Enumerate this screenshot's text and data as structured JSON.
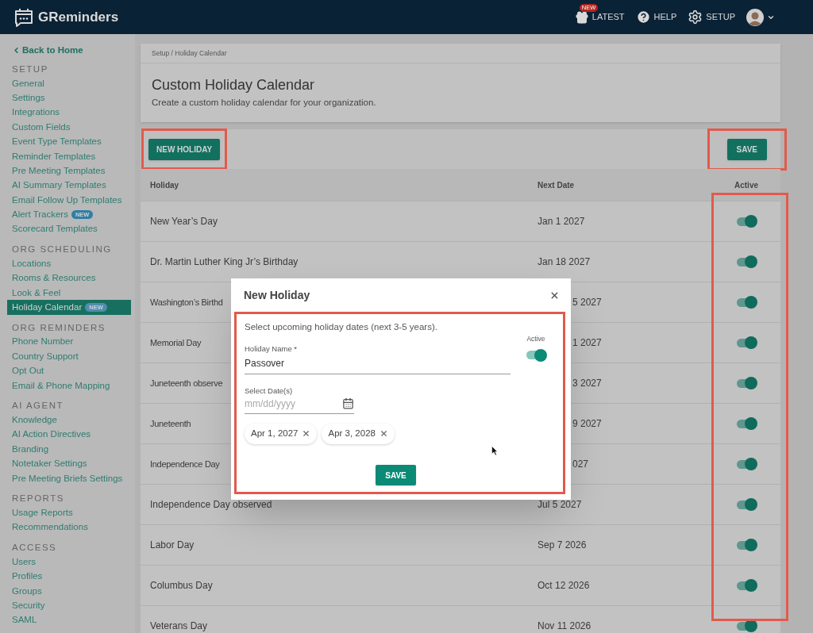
{
  "header": {
    "brand": "GReminders",
    "nav": [
      {
        "kind": "latest",
        "label": "LATEST",
        "badge": "NEW"
      },
      {
        "kind": "help",
        "label": "HELP"
      },
      {
        "kind": "setup",
        "label": "SETUP"
      },
      {
        "kind": "account"
      }
    ]
  },
  "sidebar": {
    "back_link": "Back to Home",
    "sections": [
      {
        "title": "SETUP",
        "items": [
          {
            "label": "General",
            "selected": false
          },
          {
            "label": "Settings",
            "selected": false
          },
          {
            "label": "Integrations",
            "selected": false
          },
          {
            "label": "Custom Fields",
            "selected": false
          },
          {
            "label": "Event Type Templates",
            "selected": false
          },
          {
            "label": "Reminder Templates",
            "selected": false
          },
          {
            "label": "Pre Meeting Templates",
            "selected": false
          },
          {
            "label": "AI Summary Templates",
            "selected": false
          },
          {
            "label": "Email Follow Up Templates",
            "selected": false
          },
          {
            "label": "Alert Trackers",
            "badge": "NEW",
            "selected": false
          },
          {
            "label": "Scorecard Templates",
            "selected": false
          }
        ]
      },
      {
        "title": "ORG SCHEDULING",
        "items": [
          {
            "label": "Locations",
            "selected": false
          },
          {
            "label": "Rooms & Resources",
            "selected": false
          },
          {
            "label": "Look & Feel",
            "selected": false
          },
          {
            "label": "Holiday Calendar",
            "badge": "NEW",
            "selected": true
          }
        ]
      },
      {
        "title": "ORG REMINDERS",
        "items": [
          {
            "label": "Phone Number",
            "selected": false
          },
          {
            "label": "Country Support",
            "selected": false
          },
          {
            "label": "Opt Out",
            "selected": false
          },
          {
            "label": "Email & Phone Mapping",
            "selected": false
          }
        ]
      },
      {
        "title": "AI AGENT",
        "items": [
          {
            "label": "Knowledge",
            "selected": false
          },
          {
            "label": "AI Action Directives",
            "selected": false
          },
          {
            "label": "Branding",
            "selected": false
          },
          {
            "label": "Notetaker Settings",
            "selected": false
          },
          {
            "label": "Pre Meeting Briefs Settings",
            "selected": false
          }
        ]
      },
      {
        "title": "REPORTS",
        "items": [
          {
            "label": "Usage Reports",
            "selected": false
          },
          {
            "label": "Recommendations",
            "selected": false
          }
        ]
      },
      {
        "title": "ACCESS",
        "items": [
          {
            "label": "Users",
            "selected": false
          },
          {
            "label": "Profiles",
            "selected": false
          },
          {
            "label": "Groups",
            "selected": false
          },
          {
            "label": "Security",
            "selected": false
          },
          {
            "label": "SAML",
            "selected": false
          }
        ]
      }
    ]
  },
  "page": {
    "breadcrumb": "Setup / Holiday Calendar",
    "title": "Custom Holiday Calendar",
    "subtitle": "Create a custom holiday calendar for your organization.",
    "new_button": {
      "label": "NEW HOLIDAY",
      "highlighted": true
    },
    "save_button": {
      "label": "SAVE",
      "highlighted": true
    }
  },
  "table": {
    "columns": [
      {
        "label": "Holiday"
      },
      {
        "label": "Next Date"
      },
      {
        "label": "Active",
        "highlighted": true
      }
    ],
    "rows": [
      {
        "holiday": "New Year’s Day",
        "next_date": "Jan 1 2027",
        "active": true,
        "partly_hidden": false
      },
      {
        "holiday": "Dr. Martin Luther King Jr’s Birthday",
        "next_date": "Jan 18 2027",
        "active": true,
        "partly_hidden": false
      },
      {
        "holiday": "Washington’s Birthd",
        "next_date": "5 2027",
        "active": true,
        "partly_hidden": true
      },
      {
        "holiday": "Memorial Day",
        "next_date": "1 2027",
        "active": true,
        "partly_hidden": true
      },
      {
        "holiday": "Juneteenth observe",
        "next_date": "3 2027",
        "active": true,
        "partly_hidden": true
      },
      {
        "holiday": "Juneteenth",
        "next_date": "9 2027",
        "active": true,
        "partly_hidden": true
      },
      {
        "holiday": "Independence Day",
        "next_date": "027",
        "active": true,
        "partly_hidden": true
      },
      {
        "holiday": "Independence Day observed",
        "next_date": "Jul 5 2027",
        "active": true,
        "partly_hidden": false
      },
      {
        "holiday": "Labor Day",
        "next_date": "Sep 7 2026",
        "active": true,
        "partly_hidden": false
      },
      {
        "holiday": "Columbus Day",
        "next_date": "Oct 12 2026",
        "active": true,
        "partly_hidden": false
      },
      {
        "holiday": "Veterans Day",
        "next_date": "Nov 11 2026",
        "active": true,
        "partly_hidden": false
      }
    ]
  },
  "dialog": {
    "title": "New Holiday",
    "highlighted": true,
    "hint": "Select upcoming holiday dates (next 3-5 years).",
    "name_label": "Holiday Name *",
    "name_value": "Passover",
    "active_label": "Active",
    "active": true,
    "date_label": "Select Date(s)",
    "date_placeholder": "mm/dd/yyyy",
    "chips": [
      {
        "label": "Apr 1, 2027"
      },
      {
        "label": "Apr 3, 2028"
      }
    ],
    "save_label": "SAVE"
  }
}
